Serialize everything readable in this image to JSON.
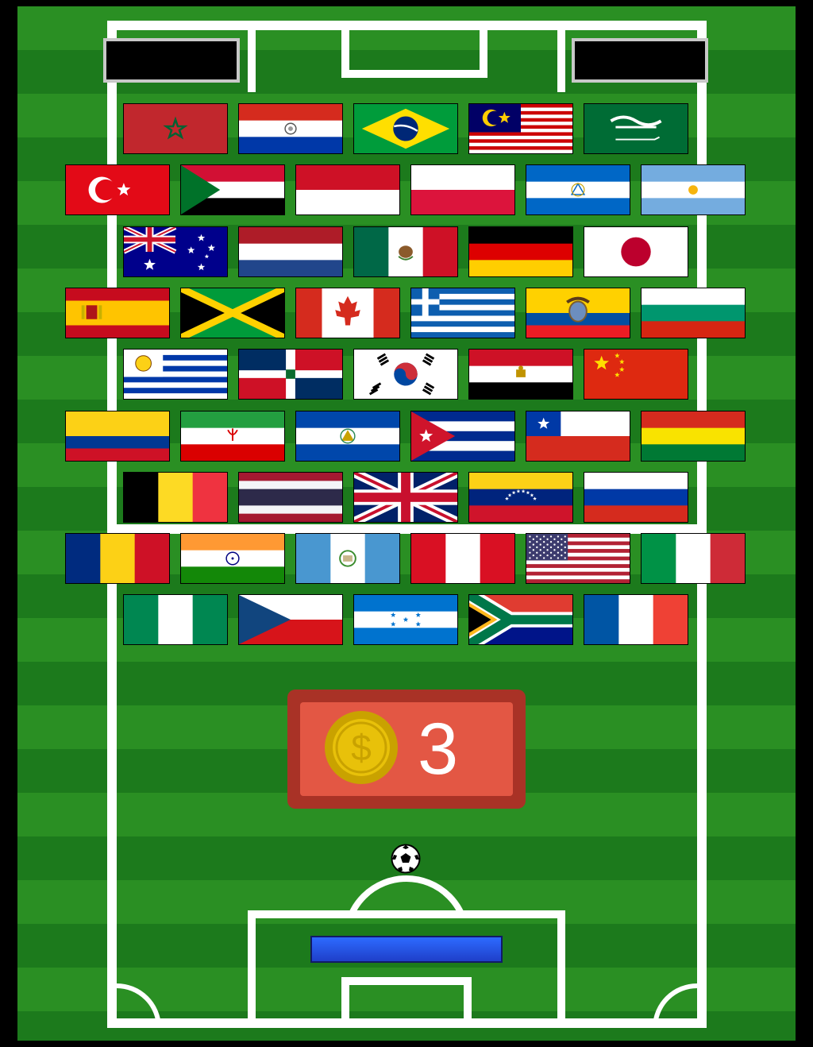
{
  "game": {
    "title": "",
    "mode": "soccer-brick-breaker"
  },
  "hud": {
    "left_score": "",
    "right_score": "",
    "coins": "3",
    "coin_icon": "dollar-coin-icon"
  },
  "colors": {
    "grass_dark": "#1c7a1c",
    "grass_light": "#2a8f23",
    "line": "#ffffff",
    "paddle": "#2a54e6",
    "coin_panel": "#e35744",
    "coin_border": "#a93226",
    "coin": "#e6b800"
  },
  "flag_rows": [
    [
      "morocco",
      "paraguay",
      "brazil",
      "malaysia",
      "saudi-arabia"
    ],
    [
      "turkey",
      "sudan",
      "indonesia",
      "poland",
      "nicaragua",
      "argentina"
    ],
    [
      "australia",
      "netherlands",
      "mexico",
      "germany",
      "japan"
    ],
    [
      "spain",
      "jamaica",
      "canada",
      "greece",
      "ecuador",
      "bulgaria"
    ],
    [
      "uruguay",
      "dominican-republic",
      "south-korea",
      "egypt",
      "china"
    ],
    [
      "colombia",
      "iran",
      "el-salvador",
      "cuba",
      "chile",
      "bolivia"
    ],
    [
      "belgium",
      "thailand",
      "united-kingdom",
      "venezuela",
      "russia"
    ],
    [
      "romania",
      "india",
      "guatemala",
      "peru",
      "united-states",
      "italy"
    ],
    [
      "nigeria",
      "czech-republic",
      "honduras",
      "south-africa",
      "france"
    ]
  ]
}
